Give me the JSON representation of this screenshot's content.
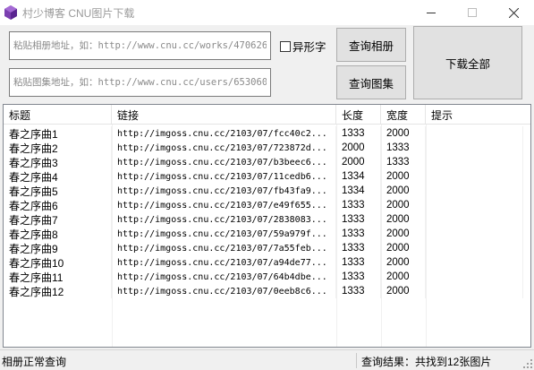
{
  "window": {
    "title": "村少博客 CNU图片下载",
    "brand_color": "#7b3fb0",
    "minimize_icon": "minimize-icon",
    "maximize_icon": "maximize-icon",
    "close_icon": "close-icon"
  },
  "inputs": {
    "album_placeholder": "粘贴相册地址，如：http://www.cnu.cc/works/470626",
    "album_value": "",
    "collection_placeholder": "粘贴图集地址，如：http://www.cnu.cc/users/653060",
    "collection_value": ""
  },
  "controls": {
    "variant_checkbox_label": "异形字",
    "variant_checked": false,
    "query_album_label": "查询相册",
    "query_collection_label": "查询图集",
    "download_all_label": "下载全部"
  },
  "table": {
    "columns": [
      "标题",
      "链接",
      "长度",
      "宽度",
      "提示"
    ],
    "rows": [
      {
        "title": "春之序曲1",
        "link": "http://imgoss.cnu.cc/2103/07/fcc40c2...",
        "length": "1333",
        "width": "2000",
        "tip": ""
      },
      {
        "title": "春之序曲2",
        "link": "http://imgoss.cnu.cc/2103/07/723872d...",
        "length": "2000",
        "width": "1333",
        "tip": ""
      },
      {
        "title": "春之序曲3",
        "link": "http://imgoss.cnu.cc/2103/07/b3beec6...",
        "length": "2000",
        "width": "1333",
        "tip": ""
      },
      {
        "title": "春之序曲4",
        "link": "http://imgoss.cnu.cc/2103/07/11cedb6...",
        "length": "1334",
        "width": "2000",
        "tip": ""
      },
      {
        "title": "春之序曲5",
        "link": "http://imgoss.cnu.cc/2103/07/fb43fa9...",
        "length": "1334",
        "width": "2000",
        "tip": ""
      },
      {
        "title": "春之序曲6",
        "link": "http://imgoss.cnu.cc/2103/07/e49f655...",
        "length": "1333",
        "width": "2000",
        "tip": ""
      },
      {
        "title": "春之序曲7",
        "link": "http://imgoss.cnu.cc/2103/07/2838083...",
        "length": "1333",
        "width": "2000",
        "tip": ""
      },
      {
        "title": "春之序曲8",
        "link": "http://imgoss.cnu.cc/2103/07/59a979f...",
        "length": "1333",
        "width": "2000",
        "tip": ""
      },
      {
        "title": "春之序曲9",
        "link": "http://imgoss.cnu.cc/2103/07/7a55feb...",
        "length": "1333",
        "width": "2000",
        "tip": ""
      },
      {
        "title": "春之序曲10",
        "link": "http://imgoss.cnu.cc/2103/07/a94de77...",
        "length": "1333",
        "width": "2000",
        "tip": ""
      },
      {
        "title": "春之序曲11",
        "link": "http://imgoss.cnu.cc/2103/07/64b4dbe...",
        "length": "1333",
        "width": "2000",
        "tip": ""
      },
      {
        "title": "春之序曲12",
        "link": "http://imgoss.cnu.cc/2103/07/0eeb8c6...",
        "length": "1333",
        "width": "2000",
        "tip": ""
      }
    ]
  },
  "status": {
    "left": "相册正常查询",
    "right": "查询结果：共找到12张图片"
  }
}
